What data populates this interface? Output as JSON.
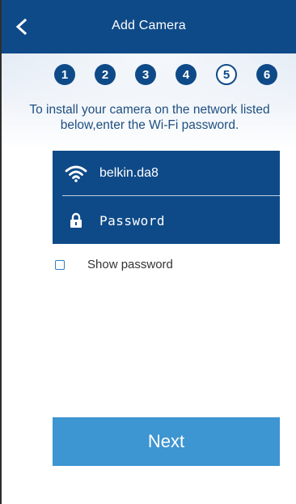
{
  "header": {
    "title": "Add Camera",
    "back_icon": "chevron-left-icon"
  },
  "steps": {
    "items": [
      "1",
      "2",
      "3",
      "4",
      "5",
      "6"
    ],
    "current": 5
  },
  "instruction": "To install your camera on the network listed below,enter the Wi-Fi password.",
  "network": {
    "ssid": "belkin.da8",
    "wifi_icon": "wifi-icon",
    "lock_icon": "lock-icon",
    "password_placeholder": "Password",
    "password_value": ""
  },
  "show_password": {
    "label": "Show password",
    "checked": false
  },
  "next_button": {
    "label": "Next"
  },
  "colors": {
    "primary": "#0f4a88",
    "button": "#3d95d1",
    "text_blue": "#1f4f80"
  }
}
